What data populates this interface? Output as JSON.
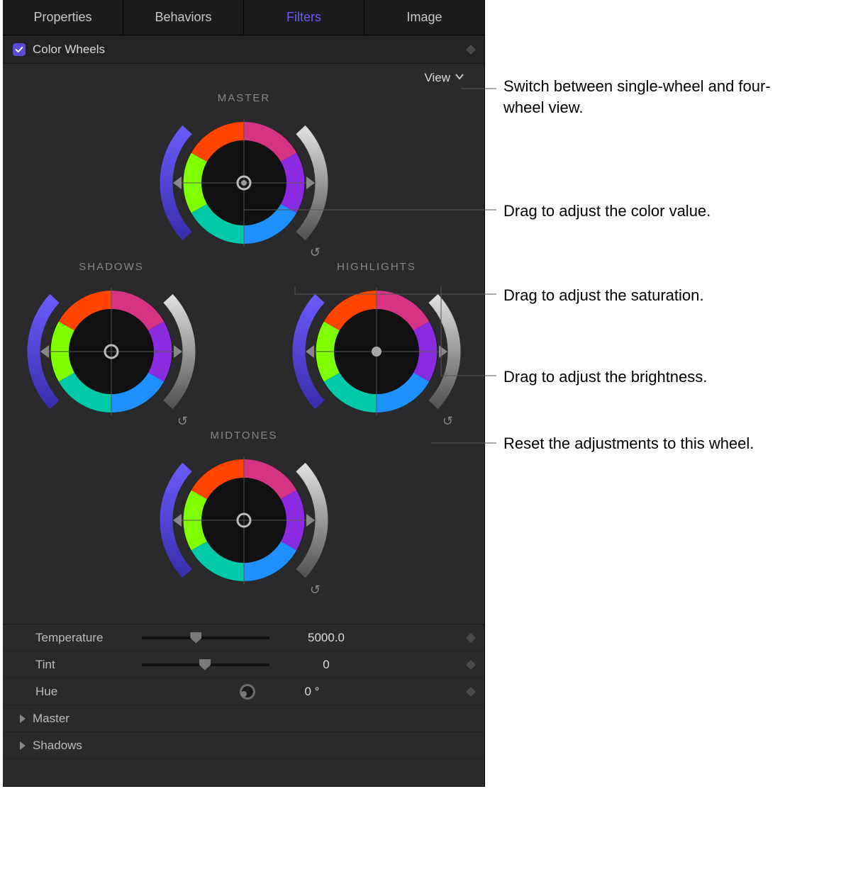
{
  "tabs": [
    "Properties",
    "Behaviors",
    "Filters",
    "Image"
  ],
  "active_tab_index": 2,
  "section": {
    "title": "Color Wheels",
    "checked": true
  },
  "view_menu": {
    "label": "View"
  },
  "wheels": {
    "master": {
      "label": "MASTER"
    },
    "shadows": {
      "label": "SHADOWS"
    },
    "highlights": {
      "label": "HIGHLIGHTS"
    },
    "midtones": {
      "label": "MIDTONES"
    }
  },
  "params": {
    "temperature": {
      "label": "Temperature",
      "value": "5000.0",
      "slider_pos": 0.4
    },
    "tint": {
      "label": "Tint",
      "value": "0",
      "slider_pos": 0.47
    },
    "hue": {
      "label": "Hue",
      "value": "0 °"
    }
  },
  "disclosures": [
    "Master",
    "Shadows"
  ],
  "callouts": {
    "view": "Switch between single-wheel and four-wheel view.",
    "color": "Drag to adjust the color value.",
    "saturation": "Drag to adjust the saturation.",
    "brightness": "Drag to adjust the brightness.",
    "reset": "Reset the adjustments to this wheel."
  }
}
